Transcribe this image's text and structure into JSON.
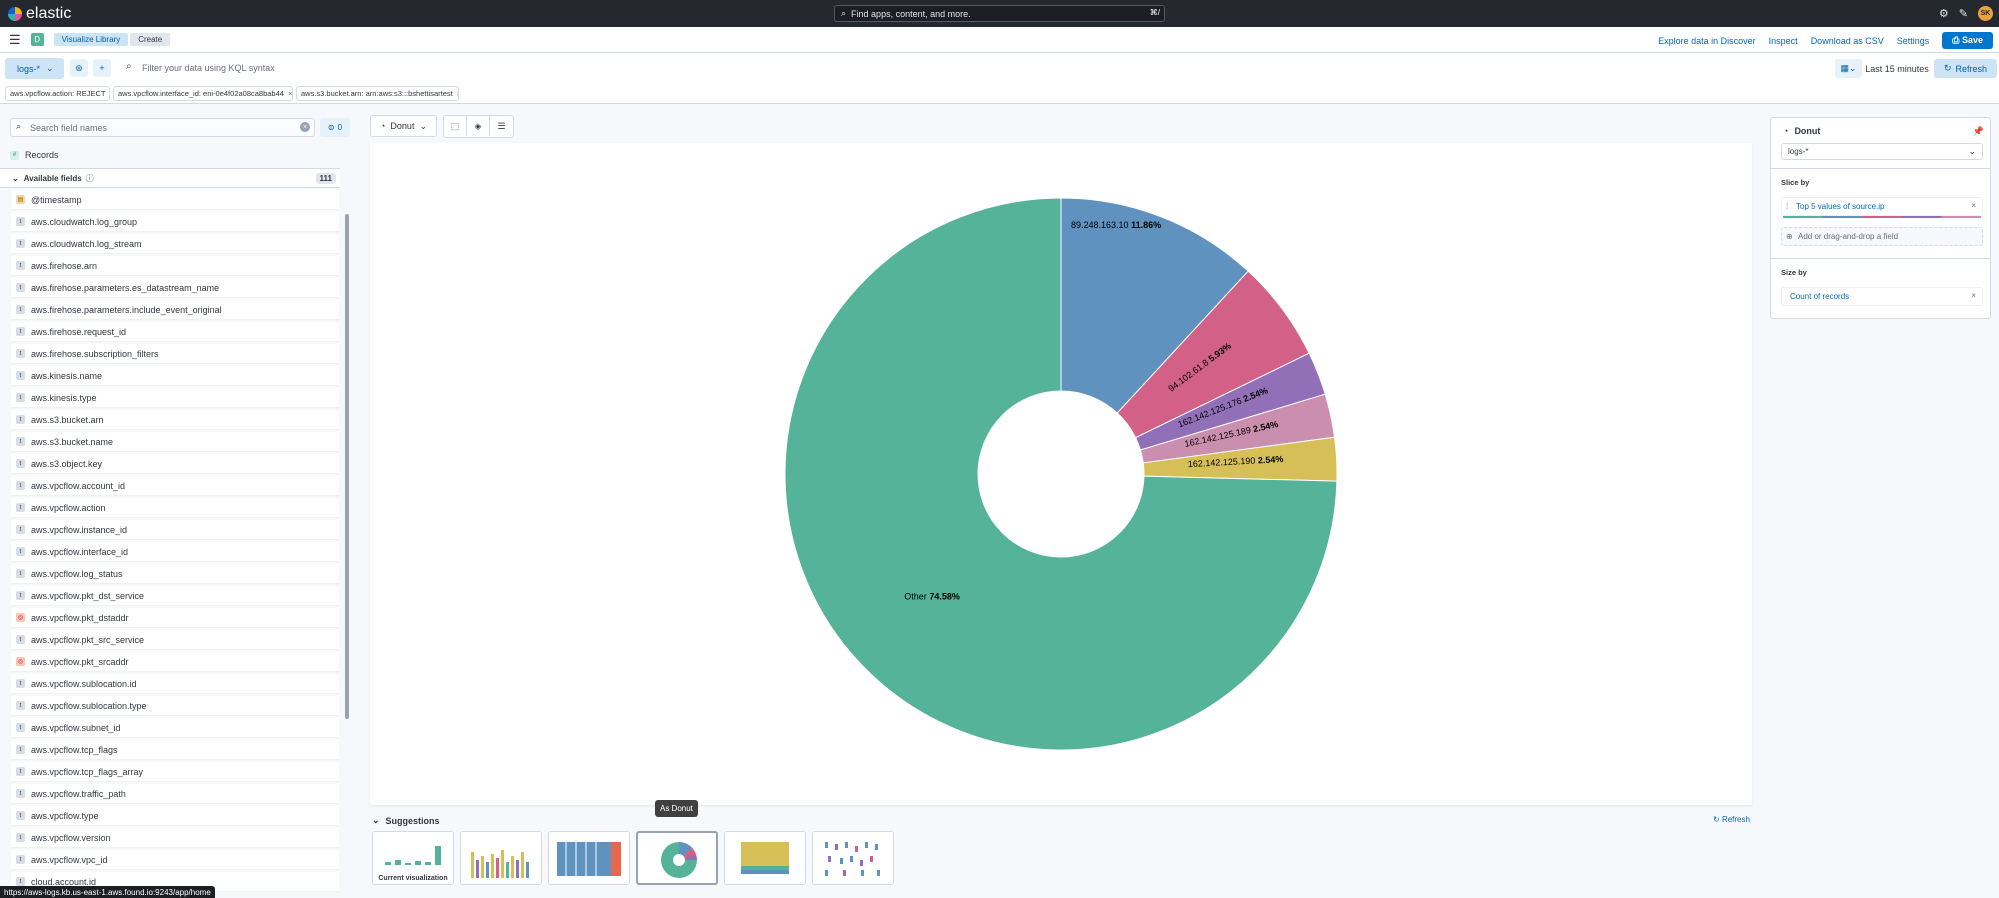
{
  "header": {
    "logo_text": "elastic",
    "search_placeholder": "Find apps, content, and more.",
    "search_shortcut": "⌘/",
    "avatar_initials": "SK"
  },
  "breadcrumbs": {
    "space_letter": "D",
    "items": [
      "Visualize Library",
      "Create"
    ]
  },
  "toplinks": {
    "explore": "Explore data in Discover",
    "inspect": "Inspect",
    "download": "Download as CSV",
    "settings": "Settings",
    "save": "Save"
  },
  "query": {
    "data_view": "logs-*",
    "placeholder": "Filter your data using KQL syntax",
    "time_range": "Last 15 minutes",
    "refresh": "Refresh"
  },
  "filters": [
    "aws.vpcflow.action: REJECT",
    "aws.vpcflow.interface_id: eni-0e4f02a08ca8bab44",
    "aws.s3.bucket.arn: arn:aws:s3:::bshettisartest"
  ],
  "sidebar": {
    "search_placeholder": "Search field names",
    "filter_count": "0",
    "records_label": "Records",
    "available_label": "Available fields",
    "available_count": "111",
    "fields": [
      {
        "name": "@timestamp",
        "type": "date"
      },
      {
        "name": "aws.cloudwatch.log_group",
        "type": "string"
      },
      {
        "name": "aws.cloudwatch.log_stream",
        "type": "string"
      },
      {
        "name": "aws.firehose.arn",
        "type": "string"
      },
      {
        "name": "aws.firehose.parameters.es_datastream_name",
        "type": "string"
      },
      {
        "name": "aws.firehose.parameters.include_event_original",
        "type": "string"
      },
      {
        "name": "aws.firehose.request_id",
        "type": "string"
      },
      {
        "name": "aws.firehose.subscription_filters",
        "type": "string"
      },
      {
        "name": "aws.kinesis.name",
        "type": "string"
      },
      {
        "name": "aws.kinesis.type",
        "type": "string"
      },
      {
        "name": "aws.s3.bucket.arn",
        "type": "string"
      },
      {
        "name": "aws.s3.bucket.name",
        "type": "string"
      },
      {
        "name": "aws.s3.object.key",
        "type": "string"
      },
      {
        "name": "aws.vpcflow.account_id",
        "type": "string"
      },
      {
        "name": "aws.vpcflow.action",
        "type": "string"
      },
      {
        "name": "aws.vpcflow.instance_id",
        "type": "string"
      },
      {
        "name": "aws.vpcflow.interface_id",
        "type": "string"
      },
      {
        "name": "aws.vpcflow.log_status",
        "type": "string"
      },
      {
        "name": "aws.vpcflow.pkt_dst_service",
        "type": "string"
      },
      {
        "name": "aws.vpcflow.pkt_dstaddr",
        "type": "ip"
      },
      {
        "name": "aws.vpcflow.pkt_src_service",
        "type": "string"
      },
      {
        "name": "aws.vpcflow.pkt_srcaddr",
        "type": "ip"
      },
      {
        "name": "aws.vpcflow.sublocation.id",
        "type": "string"
      },
      {
        "name": "aws.vpcflow.sublocation.type",
        "type": "string"
      },
      {
        "name": "aws.vpcflow.subnet_id",
        "type": "string"
      },
      {
        "name": "aws.vpcflow.tcp_flags",
        "type": "string"
      },
      {
        "name": "aws.vpcflow.tcp_flags_array",
        "type": "string"
      },
      {
        "name": "aws.vpcflow.traffic_path",
        "type": "string"
      },
      {
        "name": "aws.vpcflow.type",
        "type": "string"
      },
      {
        "name": "aws.vpcflow.version",
        "type": "string"
      },
      {
        "name": "aws.vpcflow.vpc_id",
        "type": "string"
      },
      {
        "name": "cloud.account.id",
        "type": "string"
      }
    ]
  },
  "workspace": {
    "chart_type_label": "Donut",
    "suggestions_label": "Suggestions",
    "suggestions_refresh": "Refresh",
    "current_viz_label": "Current visualization",
    "tooltip": "As Donut"
  },
  "config": {
    "title": "Donut",
    "data_view": "logs-*",
    "slice_by_label": "Slice by",
    "slice_by_value": "Top 5 values of source.ip",
    "add_field": "Add or drag-and-drop a field",
    "size_by_label": "Size by",
    "size_by_value": "Count of records"
  },
  "status_url": "https://aws-logs.kb.us-east-1.aws.found.io:9243/app/home",
  "chart_data": {
    "type": "pie",
    "variant": "donut",
    "slices": [
      {
        "label": "89.248.163.10",
        "percent": 11.86,
        "color": "#6092c0"
      },
      {
        "label": "94.102.61.8",
        "percent": 5.93,
        "color": "#d36086"
      },
      {
        "label": "162.142.125.176",
        "percent": 2.54,
        "color": "#9170b8"
      },
      {
        "label": "162.142.125.189",
        "percent": 2.54,
        "color": "#ca8eae"
      },
      {
        "label": "162.142.125.190",
        "percent": 2.54,
        "color": "#d6bf57"
      },
      {
        "label": "Other",
        "percent": 74.58,
        "color": "#54b399"
      }
    ]
  }
}
